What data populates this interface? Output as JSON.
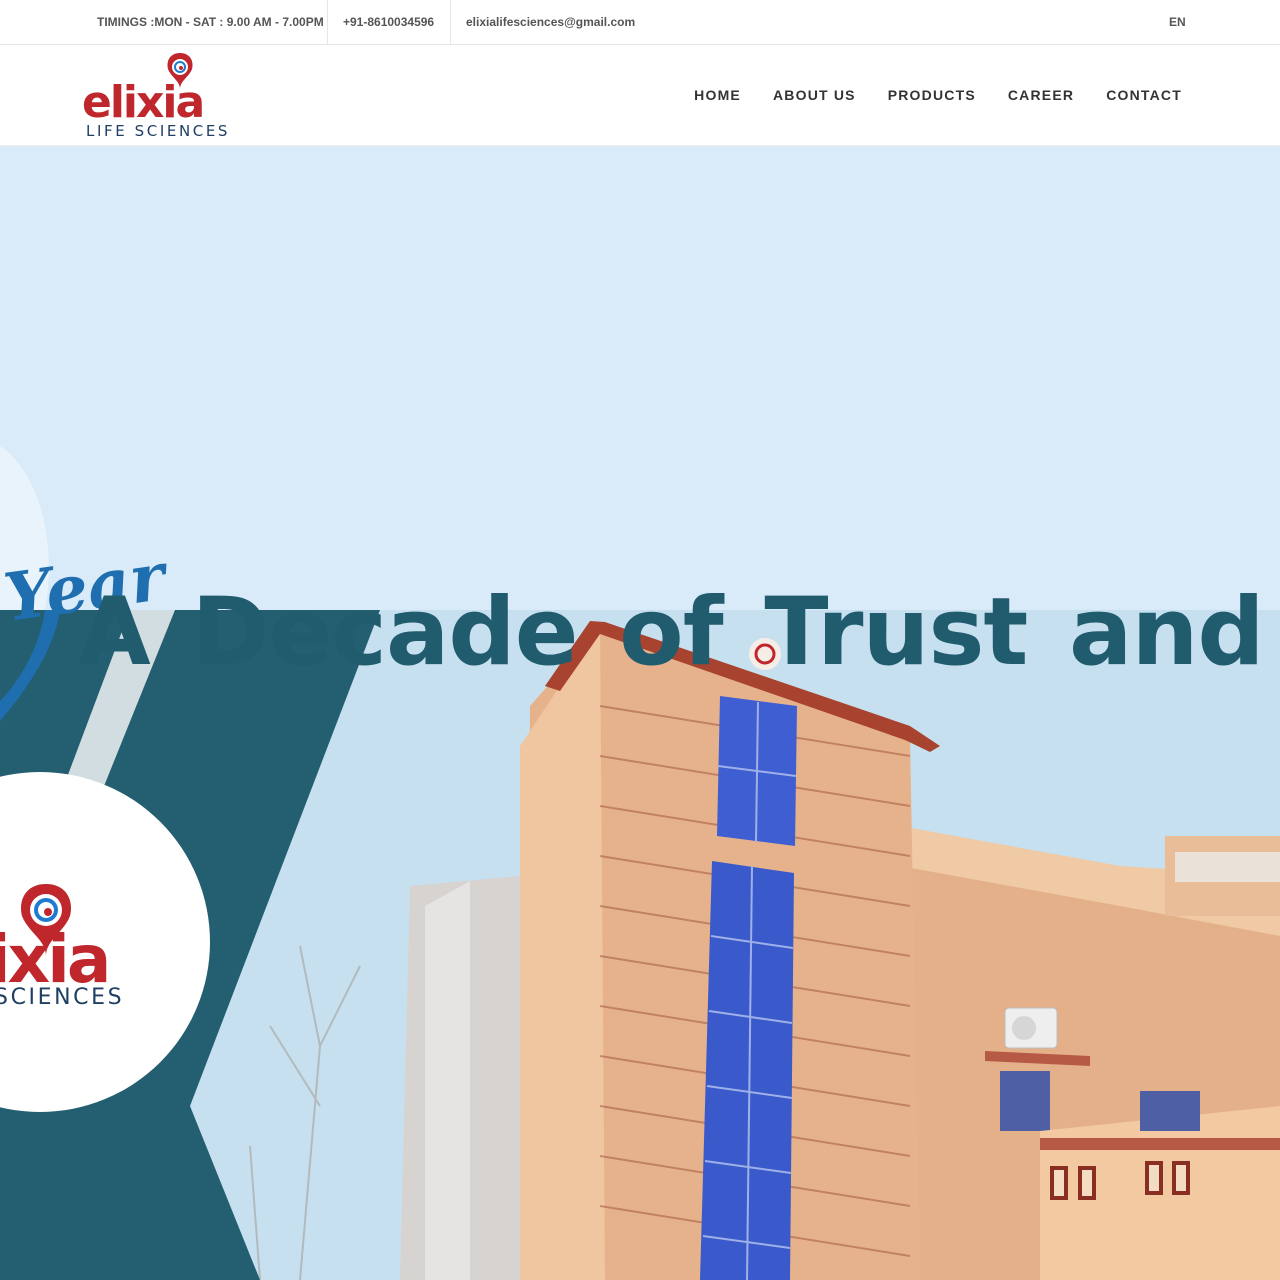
{
  "topbar": {
    "timings": "TIMINGS :MON - SAT : 9.00 AM - 7.00PM",
    "phone": "+91-8610034596",
    "email": "elixialifesciences@gmail.com",
    "language": "EN"
  },
  "brand": {
    "logo_text": "elixia",
    "logo_subtext": "LIFE SCIENCES",
    "colors": {
      "red": "#c0272d",
      "navy": "#1f3f63",
      "blue": "#1e7bd0"
    }
  },
  "nav": {
    "items": [
      "HOME",
      "ABOUT US",
      "PRODUCTS",
      "CAREER",
      "CONTACT"
    ]
  },
  "hero": {
    "headline": "A Decade of Trust and Con",
    "script_text": "Year",
    "circle_logo_text": "ixia",
    "circle_logo_subtext": "SCIENCES",
    "colors": {
      "sky": "#d9eaf8",
      "teal": "#235f70",
      "headline": "#215c6e",
      "building": "#e8b48c"
    }
  }
}
